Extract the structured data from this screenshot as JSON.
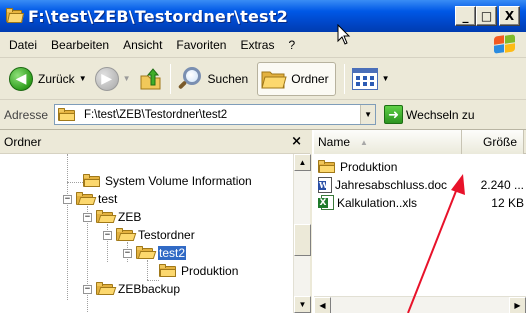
{
  "window": {
    "title": "F:\\test\\ZEB\\Testordner\\test2",
    "minimize_glyph": "_",
    "maximize_glyph": "□",
    "close_glyph": "X"
  },
  "menu": {
    "items": [
      "Datei",
      "Bearbeiten",
      "Ansicht",
      "Favoriten",
      "Extras",
      "?"
    ]
  },
  "toolbar": {
    "back_label": "Zurück",
    "search_label": "Suchen",
    "folders_label": "Ordner"
  },
  "address": {
    "label": "Adresse",
    "value": "F:\\test\\ZEB\\Testordner\\test2",
    "go_label": "Wechseln zu"
  },
  "folders_panel": {
    "title": "Ordner",
    "close_glyph": "×",
    "tree": [
      {
        "label": "System Volume Information",
        "expander": ""
      },
      {
        "label": "test",
        "expander": "−"
      },
      {
        "label": "ZEB",
        "expander": "−"
      },
      {
        "label": "Testordner",
        "expander": "−"
      },
      {
        "label": "test2",
        "expander": "−",
        "selected": true
      },
      {
        "label": "Produktion",
        "expander": ""
      },
      {
        "label": "ZEBbackup",
        "expander": "−"
      }
    ]
  },
  "files_panel": {
    "columns": {
      "name": "Name",
      "size": "Größe"
    },
    "files": [
      {
        "name": "Produktion",
        "size": "",
        "icon": "folder-icon"
      },
      {
        "name": "Jahresabschluss.doc",
        "size": "2.240 ...",
        "icon": "word-document-icon"
      },
      {
        "name": "Kalkulation..xls",
        "size": "12 KB",
        "icon": "excel-document-icon"
      }
    ]
  },
  "colors": {
    "titlebar": "#0054e3",
    "selection": "#316ac5",
    "annotation_arrow": "#e8122a",
    "chrome": "#ece9d8"
  }
}
